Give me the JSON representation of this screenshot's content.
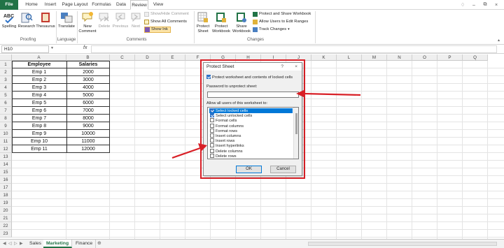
{
  "menu": {
    "tabs": [
      "File",
      "Home",
      "Insert",
      "Page Layout",
      "Formulas",
      "Data",
      "Review",
      "View"
    ],
    "active": "Review"
  },
  "ribbon": {
    "proofing": {
      "label": "Proofing",
      "spelling": "Spelling",
      "research": "Research",
      "thesaurus": "Thesaurus",
      "spelling_icon_text": "ABC"
    },
    "language": {
      "label": "Language",
      "translate": "Translate"
    },
    "comments": {
      "label": "Comments",
      "new_comment": [
        "New",
        "Comment"
      ],
      "delete": "Delete",
      "previous": "Previous",
      "next": "Next",
      "show_hide": "Show/Hide Comment",
      "show_all": "Show All Comments",
      "show_ink": "Show Ink"
    },
    "changes": {
      "label": "Changes",
      "protect_sheet": [
        "Protect",
        "Sheet"
      ],
      "protect_workbook": [
        "Protect",
        "Workbook"
      ],
      "share_workbook": [
        "Share",
        "Workbook"
      ],
      "protect_share": "Protect and Share Workbook",
      "allow_users": "Allow Users to Edit Ranges",
      "track_changes": "Track Changes"
    }
  },
  "formula_bar": {
    "name_box": "H10",
    "fx": "fx",
    "value": ""
  },
  "columns": [
    "A",
    "B",
    "C",
    "D",
    "E",
    "F",
    "G",
    "H",
    "I",
    "J",
    "K",
    "L",
    "M",
    "N",
    "O",
    "P",
    "Q"
  ],
  "rows": [
    "1",
    "2",
    "3",
    "4",
    "5",
    "6",
    "7",
    "8",
    "9",
    "10",
    "11",
    "12",
    "13",
    "14",
    "15",
    "16",
    "17",
    "18",
    "19",
    "20",
    "21",
    "22",
    "23"
  ],
  "table": {
    "headers": [
      "Employee",
      "Salaries"
    ],
    "rows": [
      [
        "Emp 1",
        "2000"
      ],
      [
        "Emp 2",
        "3000"
      ],
      [
        "Emp 3",
        "4000"
      ],
      [
        "Emp 4",
        "5000"
      ],
      [
        "Emp 5",
        "6000"
      ],
      [
        "Emp 6",
        "7000"
      ],
      [
        "Emp 7",
        "8000"
      ],
      [
        "Emp 8",
        "9000"
      ],
      [
        "Emp 9",
        "10000"
      ],
      [
        "Emp 10",
        "11000"
      ],
      [
        "Emp 11",
        "12000"
      ]
    ]
  },
  "sheets": {
    "tabs": [
      "Sales",
      "Marketing",
      "Finance"
    ],
    "active": "Marketing"
  },
  "dialog": {
    "title": "Protect Sheet",
    "help": "?",
    "close": "×",
    "protect_contents_label": "Protect worksheet and contents of locked cells",
    "protect_contents_checked": true,
    "password_label": "Password to unprotect sheet:",
    "password_value": "",
    "allow_label": "Allow all users of this worksheet to:",
    "permissions": [
      {
        "label": "Select locked cells",
        "checked": true
      },
      {
        "label": "Select unlocked cells",
        "checked": true
      },
      {
        "label": "Format cells",
        "checked": false
      },
      {
        "label": "Format columns",
        "checked": false
      },
      {
        "label": "Format rows",
        "checked": false
      },
      {
        "label": "Insert columns",
        "checked": false
      },
      {
        "label": "Insert rows",
        "checked": false
      },
      {
        "label": "Insert hyperlinks",
        "checked": false
      },
      {
        "label": "Delete columns",
        "checked": false
      },
      {
        "label": "Delete rows",
        "checked": false
      }
    ],
    "ok_label": "OK",
    "cancel_label": "Cancel"
  },
  "colors": {
    "excel_green": "#217346",
    "annotation_red": "#d81f26",
    "selection_blue": "#0078d7"
  }
}
